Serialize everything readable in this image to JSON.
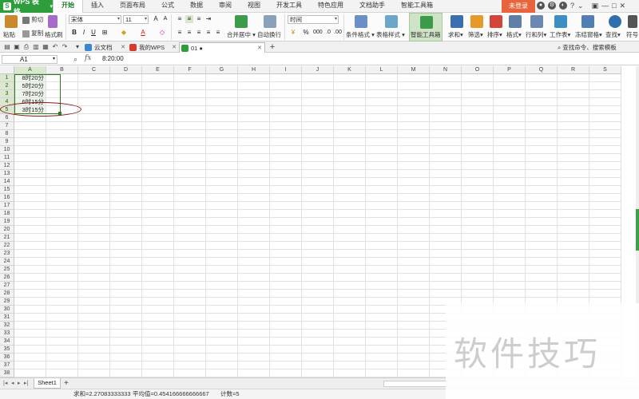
{
  "app": {
    "name": "WPS 表格",
    "menu_tabs": [
      "开始",
      "插入",
      "页面布局",
      "公式",
      "数据",
      "审阅",
      "视图",
      "开发工具",
      "特色应用",
      "文档助手",
      "智能工具箱"
    ],
    "active_tab": "开始",
    "login_label": "未登录"
  },
  "ribbon": {
    "paste": "粘贴",
    "cut": "剪切",
    "copy": "复制",
    "format_painter": "格式刷",
    "font_name": "宋体",
    "font_size": "11",
    "bold": "B",
    "italic": "I",
    "underline": "U",
    "merge_center": "合并居中",
    "wrap_text": "自动换行",
    "number_format": "时间",
    "percent": "%",
    "conditional_format": "条件格式",
    "table_style": "表格样式",
    "smart_toolbox": "智能工具箱",
    "sum": "求和",
    "filter": "筛选",
    "sort": "排序",
    "format": "格式",
    "rows_cols": "行和列",
    "worksheet": "工作表",
    "freeze": "冻结窗格",
    "find": "查找",
    "symbol": "符号"
  },
  "tabs": {
    "cloud_docs": "云文档",
    "my_wps": "我的WPS",
    "current_doc": "01 ●",
    "search_cmd": "查找命令、搜索模板"
  },
  "formula_bar": {
    "cell_ref": "A1",
    "fx": "fx",
    "value": "8:20:00"
  },
  "grid": {
    "columns": [
      "A",
      "B",
      "C",
      "D",
      "E",
      "F",
      "G",
      "H",
      "I",
      "J",
      "K",
      "L",
      "M",
      "N",
      "O",
      "P",
      "Q",
      "R",
      "S"
    ],
    "row_count": 38,
    "selected_column": "A",
    "selected_rows": [
      1,
      2,
      3,
      4,
      5
    ],
    "cells": [
      {
        "row": 1,
        "col": "A",
        "value": "8时20分"
      },
      {
        "row": 2,
        "col": "A",
        "value": "5时20分"
      },
      {
        "row": 3,
        "col": "A",
        "value": "7时20分"
      },
      {
        "row": 4,
        "col": "A",
        "value": "6时15分"
      },
      {
        "row": 5,
        "col": "A",
        "value": "3时15分"
      }
    ]
  },
  "sheets": {
    "names": [
      "Sheet1"
    ],
    "active": "Sheet1"
  },
  "status": {
    "sum": "求和=2.27083333333",
    "average": "平均值=0.454166666666667",
    "count": "计数=5"
  },
  "watermark": "软件技巧",
  "colors": {
    "accent_green": "#2e9e3c",
    "login_orange": "#e8643c",
    "annotation_red": "#8e1a1a"
  }
}
